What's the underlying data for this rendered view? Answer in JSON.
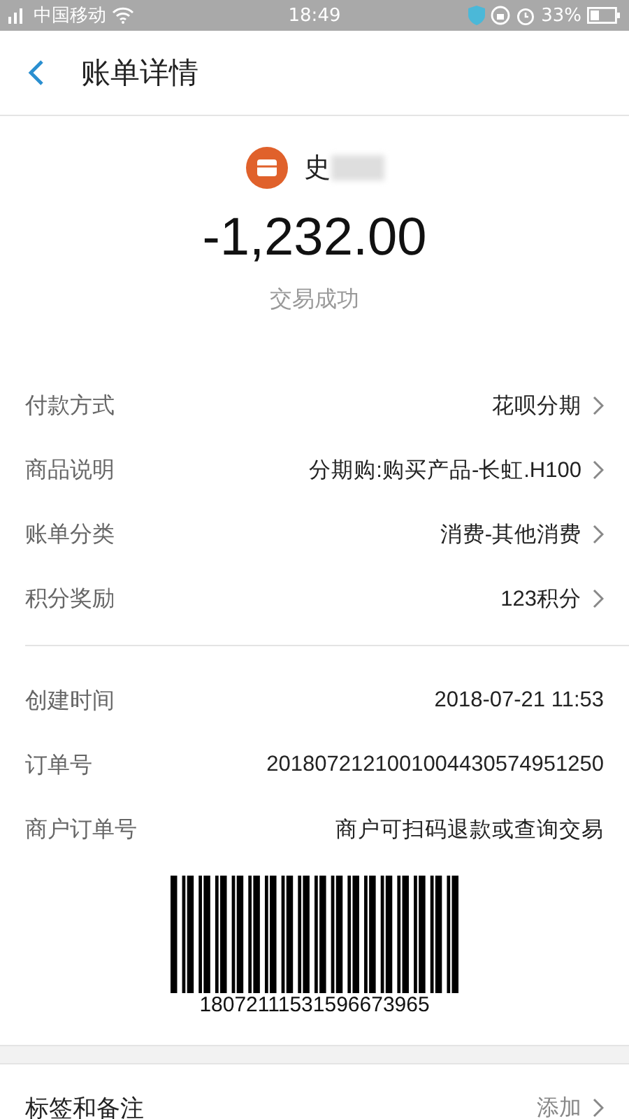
{
  "status_bar": {
    "carrier": "中国移动",
    "time": "18:49",
    "battery": "33%"
  },
  "header": {
    "title": "账单详情"
  },
  "merchant": {
    "name": "史"
  },
  "amount": "-1,232.00",
  "status": "交易成功",
  "details": [
    {
      "label": "付款方式",
      "value": "花呗分期",
      "link": true
    },
    {
      "label": "商品说明",
      "value": "分期购:购买产品-长虹.H100",
      "link": true
    },
    {
      "label": "账单分类",
      "value": "消费-其他消费",
      "link": true
    },
    {
      "label": "积分奖励",
      "value": "123积分",
      "link": true
    }
  ],
  "order_info": [
    {
      "label": "创建时间",
      "value": "2018-07-21 11:53",
      "link": false
    },
    {
      "label": "订单号",
      "value": "2018072121001004430574951250",
      "link": false
    },
    {
      "label": "商户订单号",
      "value": "商户可扫码退款或查询交易",
      "link": false
    }
  ],
  "barcode": {
    "number": "18072111531596673965"
  },
  "tags_row": {
    "label": "标签和备注",
    "action": "添加"
  }
}
